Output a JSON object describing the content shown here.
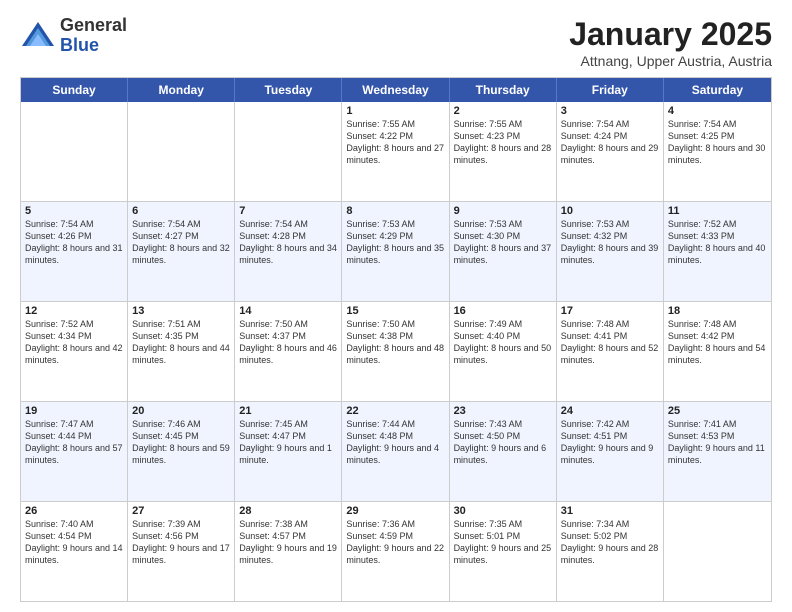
{
  "logo": {
    "general": "General",
    "blue": "Blue"
  },
  "header": {
    "title": "January 2025",
    "subtitle": "Attnang, Upper Austria, Austria"
  },
  "weekdays": [
    "Sunday",
    "Monday",
    "Tuesday",
    "Wednesday",
    "Thursday",
    "Friday",
    "Saturday"
  ],
  "rows": [
    {
      "alt": false,
      "cells": [
        {
          "day": "",
          "text": ""
        },
        {
          "day": "",
          "text": ""
        },
        {
          "day": "",
          "text": ""
        },
        {
          "day": "1",
          "text": "Sunrise: 7:55 AM\nSunset: 4:22 PM\nDaylight: 8 hours and 27 minutes."
        },
        {
          "day": "2",
          "text": "Sunrise: 7:55 AM\nSunset: 4:23 PM\nDaylight: 8 hours and 28 minutes."
        },
        {
          "day": "3",
          "text": "Sunrise: 7:54 AM\nSunset: 4:24 PM\nDaylight: 8 hours and 29 minutes."
        },
        {
          "day": "4",
          "text": "Sunrise: 7:54 AM\nSunset: 4:25 PM\nDaylight: 8 hours and 30 minutes."
        }
      ]
    },
    {
      "alt": true,
      "cells": [
        {
          "day": "5",
          "text": "Sunrise: 7:54 AM\nSunset: 4:26 PM\nDaylight: 8 hours and 31 minutes."
        },
        {
          "day": "6",
          "text": "Sunrise: 7:54 AM\nSunset: 4:27 PM\nDaylight: 8 hours and 32 minutes."
        },
        {
          "day": "7",
          "text": "Sunrise: 7:54 AM\nSunset: 4:28 PM\nDaylight: 8 hours and 34 minutes."
        },
        {
          "day": "8",
          "text": "Sunrise: 7:53 AM\nSunset: 4:29 PM\nDaylight: 8 hours and 35 minutes."
        },
        {
          "day": "9",
          "text": "Sunrise: 7:53 AM\nSunset: 4:30 PM\nDaylight: 8 hours and 37 minutes."
        },
        {
          "day": "10",
          "text": "Sunrise: 7:53 AM\nSunset: 4:32 PM\nDaylight: 8 hours and 39 minutes."
        },
        {
          "day": "11",
          "text": "Sunrise: 7:52 AM\nSunset: 4:33 PM\nDaylight: 8 hours and 40 minutes."
        }
      ]
    },
    {
      "alt": false,
      "cells": [
        {
          "day": "12",
          "text": "Sunrise: 7:52 AM\nSunset: 4:34 PM\nDaylight: 8 hours and 42 minutes."
        },
        {
          "day": "13",
          "text": "Sunrise: 7:51 AM\nSunset: 4:35 PM\nDaylight: 8 hours and 44 minutes."
        },
        {
          "day": "14",
          "text": "Sunrise: 7:50 AM\nSunset: 4:37 PM\nDaylight: 8 hours and 46 minutes."
        },
        {
          "day": "15",
          "text": "Sunrise: 7:50 AM\nSunset: 4:38 PM\nDaylight: 8 hours and 48 minutes."
        },
        {
          "day": "16",
          "text": "Sunrise: 7:49 AM\nSunset: 4:40 PM\nDaylight: 8 hours and 50 minutes."
        },
        {
          "day": "17",
          "text": "Sunrise: 7:48 AM\nSunset: 4:41 PM\nDaylight: 8 hours and 52 minutes."
        },
        {
          "day": "18",
          "text": "Sunrise: 7:48 AM\nSunset: 4:42 PM\nDaylight: 8 hours and 54 minutes."
        }
      ]
    },
    {
      "alt": true,
      "cells": [
        {
          "day": "19",
          "text": "Sunrise: 7:47 AM\nSunset: 4:44 PM\nDaylight: 8 hours and 57 minutes."
        },
        {
          "day": "20",
          "text": "Sunrise: 7:46 AM\nSunset: 4:45 PM\nDaylight: 8 hours and 59 minutes."
        },
        {
          "day": "21",
          "text": "Sunrise: 7:45 AM\nSunset: 4:47 PM\nDaylight: 9 hours and 1 minute."
        },
        {
          "day": "22",
          "text": "Sunrise: 7:44 AM\nSunset: 4:48 PM\nDaylight: 9 hours and 4 minutes."
        },
        {
          "day": "23",
          "text": "Sunrise: 7:43 AM\nSunset: 4:50 PM\nDaylight: 9 hours and 6 minutes."
        },
        {
          "day": "24",
          "text": "Sunrise: 7:42 AM\nSunset: 4:51 PM\nDaylight: 9 hours and 9 minutes."
        },
        {
          "day": "25",
          "text": "Sunrise: 7:41 AM\nSunset: 4:53 PM\nDaylight: 9 hours and 11 minutes."
        }
      ]
    },
    {
      "alt": false,
      "cells": [
        {
          "day": "26",
          "text": "Sunrise: 7:40 AM\nSunset: 4:54 PM\nDaylight: 9 hours and 14 minutes."
        },
        {
          "day": "27",
          "text": "Sunrise: 7:39 AM\nSunset: 4:56 PM\nDaylight: 9 hours and 17 minutes."
        },
        {
          "day": "28",
          "text": "Sunrise: 7:38 AM\nSunset: 4:57 PM\nDaylight: 9 hours and 19 minutes."
        },
        {
          "day": "29",
          "text": "Sunrise: 7:36 AM\nSunset: 4:59 PM\nDaylight: 9 hours and 22 minutes."
        },
        {
          "day": "30",
          "text": "Sunrise: 7:35 AM\nSunset: 5:01 PM\nDaylight: 9 hours and 25 minutes."
        },
        {
          "day": "31",
          "text": "Sunrise: 7:34 AM\nSunset: 5:02 PM\nDaylight: 9 hours and 28 minutes."
        },
        {
          "day": "",
          "text": ""
        }
      ]
    }
  ]
}
